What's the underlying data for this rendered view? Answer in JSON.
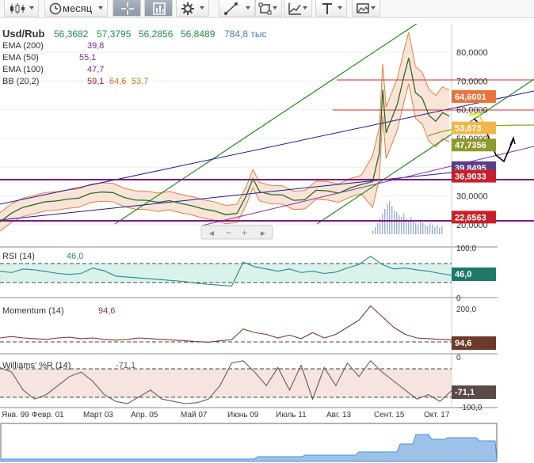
{
  "toolbar": {
    "period_label": "месяц",
    "buttons": [
      "chart-type",
      "period",
      "crosshair",
      "panels",
      "indicators",
      "draw-line",
      "shapes",
      "trend-tools",
      "text",
      "save"
    ]
  },
  "main": {
    "symbol": "Usd/Rub",
    "quote": {
      "open": "56,3682",
      "high": "57,3795",
      "low": "56,2856",
      "close": "56,8489",
      "volume": "784,8 тыс"
    },
    "indicators": [
      {
        "name": "EMA (200)",
        "values": [
          "39,8"
        ],
        "color": "#7a2a8a"
      },
      {
        "name": "EMA (50)",
        "values": [
          "55,1"
        ],
        "color": "#7a2a8a"
      },
      {
        "name": "EMA (100)",
        "values": [
          "47,7"
        ],
        "color": "#7a2a8a"
      },
      {
        "name": "BB (20,2)",
        "values": [
          "59,1",
          "64,6",
          "53,7"
        ],
        "colors": [
          "#b0202a",
          "#d8702a",
          "#b08020"
        ]
      }
    ],
    "price_axis": [
      "80,0000",
      "70,0000",
      "60,0000",
      "50,0000",
      "40,0000",
      "30,0000",
      "20,0000"
    ],
    "badges": [
      {
        "text": "64,6001",
        "bg": "#e8743a"
      },
      {
        "text": "53,673",
        "bg": "#f0b84a"
      },
      {
        "text": "47,7356",
        "bg": "#8f9a2a"
      },
      {
        "text": "39,8495",
        "bg": "#5a3d8a"
      },
      {
        "text": "36,9033",
        "bg": "#c8202a"
      },
      {
        "text": "22,6563",
        "bg": "#c8202a"
      }
    ],
    "zoom_controls": [
      "◄",
      "−",
      "+",
      "►"
    ]
  },
  "rsi": {
    "name": "RSI (14)",
    "value": "46,0",
    "axis": [
      "100,0",
      "0"
    ],
    "badge": "46,0",
    "badge_bg": "#1f7a6a"
  },
  "momentum": {
    "name": "Momentum (14)",
    "value": "94,6",
    "axis": [
      "200,0"
    ],
    "badge": "94,6",
    "badge_bg": "#6b3a2a"
  },
  "williams": {
    "name": "Williams' %R (14)",
    "value": "-71,1",
    "axis": [
      "0",
      "-100,0"
    ],
    "badge": "-71,1",
    "badge_bg": "#5a4a48"
  },
  "x_axis": [
    "Янв. 99",
    "Февр. 01",
    "Март 03",
    "Апр. 05",
    "Май 07",
    "Июнь 09",
    "Июль 11",
    "Авг. 13",
    "Сент. 15",
    "Окт. 17"
  ],
  "colors": {
    "accent_green": "#1f8f1f",
    "trend_blue": "#1a1a9a",
    "support_purple": "#7a1a8a",
    "resistance_red": "#d03030",
    "rsi_line": "#2a8a7a",
    "momentum_line": "#7a3a30",
    "williams_line": "#6a5a56",
    "navigator_fill": "#4a90d9"
  },
  "chart_data": [
    {
      "type": "line",
      "title": "Usd/Rub",
      "ylim": [
        15,
        88
      ],
      "x": [
        1998.0,
        1998.5,
        1999.0,
        1999.5,
        2000.0,
        2000.5,
        2001.0,
        2001.5,
        2002.0,
        2002.5,
        2003.0,
        2003.5,
        2004.0,
        2004.5,
        2005.0,
        2005.5,
        2006.0,
        2006.5,
        2007.0,
        2007.5,
        2008.0,
        2008.5,
        2008.9,
        2009.2,
        2009.5,
        2010.0,
        2010.5,
        2011.0,
        2011.5,
        2012.0,
        2012.5,
        2013.0,
        2013.5,
        2014.0,
        2014.5,
        2014.8,
        2014.95,
        2015.1,
        2015.3,
        2015.6,
        2015.9,
        2016.1,
        2016.4,
        2016.7,
        2017.0,
        2017.3,
        2017.6,
        2017.9
      ],
      "series": [
        {
          "values": [
            21,
            24,
            26,
            27,
            28,
            28.3,
            28.9,
            29.3,
            30.9,
            31.4,
            31.2,
            29.5,
            28.6,
            28.5,
            27.8,
            28.4,
            27.4,
            26.6,
            25.5,
            24.8,
            23.5,
            24.0,
            30.0,
            36.0,
            31.5,
            30.5,
            30.4,
            28.5,
            28.7,
            32.0,
            31.8,
            31.0,
            32.8,
            34.0,
            35.0,
            45.0,
            67.0,
            52.0,
            56.0,
            62.0,
            72.0,
            78.0,
            66.0,
            64.0,
            58.0,
            56.0,
            59.0,
            57.8
          ]
        },
        {
          "name": "EMA (200)",
          "values": []
        },
        {
          "name": "EMA (50)",
          "values": []
        },
        {
          "name": "EMA (100)",
          "values": []
        },
        {
          "name": "BB (20,2)",
          "values": []
        }
      ]
    },
    {
      "type": "line",
      "title": "RSI (14)",
      "ylim": [
        0,
        100
      ],
      "series": [
        {
          "name": "RSI (14)",
          "values": [
            55,
            52,
            60,
            58,
            54,
            50,
            48,
            50,
            62,
            56,
            44,
            42,
            40,
            38,
            36,
            34,
            32,
            28,
            26,
            24,
            22,
            75,
            65,
            60,
            55,
            60,
            52,
            55,
            50,
            53,
            62,
            70,
            88,
            70,
            60,
            62,
            58,
            55,
            50,
            46
          ]
        }
      ]
    },
    {
      "type": "line",
      "title": "Momentum (14)",
      "ylim": [
        0,
        200
      ],
      "series": [
        {
          "name": "Momentum (14)",
          "values": [
            100,
            104,
            100,
            98,
            96,
            100,
            102,
            98,
            100,
            96,
            94,
            96,
            100,
            98,
            96,
            94,
            92,
            90,
            88,
            92,
            95,
            125,
            115,
            110,
            100,
            108,
            98,
            115,
            100,
            110,
            130,
            150,
            190,
            160,
            130,
            110,
            100,
            98,
            96,
            94.6
          ]
        }
      ]
    },
    {
      "type": "line",
      "title": "Williams' %R (14)",
      "ylim": [
        -100,
        0
      ],
      "series": [
        {
          "name": "Williams' %R (14)",
          "values": [
            -20,
            -30,
            -70,
            -90,
            -80,
            -60,
            -40,
            -30,
            -50,
            -80,
            -95,
            -100,
            -85,
            -70,
            -90,
            -95,
            -100,
            -98,
            -90,
            -60,
            -10,
            -5,
            -30,
            -60,
            -20,
            -70,
            -15,
            -90,
            -20,
            -60,
            -10,
            -40,
            -5,
            -30,
            -50,
            -70,
            -90,
            -80,
            -95,
            -71.1
          ]
        }
      ]
    }
  ]
}
